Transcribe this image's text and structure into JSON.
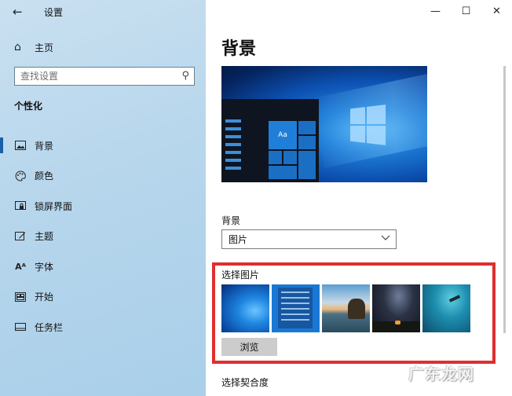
{
  "window": {
    "title": "设置",
    "controls": {
      "minimize": "—",
      "maximize": "☐",
      "close": "✕"
    }
  },
  "sidebar": {
    "home_label": "主页",
    "search_placeholder": "查找设置",
    "section_title": "个性化",
    "items": [
      {
        "label": "背景",
        "icon": "picture-icon",
        "active": true
      },
      {
        "label": "颜色",
        "icon": "palette-icon",
        "active": false
      },
      {
        "label": "锁屏界面",
        "icon": "lock-screen-icon",
        "active": false
      },
      {
        "label": "主题",
        "icon": "theme-brush-icon",
        "active": false
      },
      {
        "label": "字体",
        "icon": "font-icon",
        "active": false
      },
      {
        "label": "开始",
        "icon": "start-grid-icon",
        "active": false
      },
      {
        "label": "任务栏",
        "icon": "taskbar-icon",
        "active": false
      }
    ]
  },
  "main": {
    "page_title": "背景",
    "preview": {
      "tile_text": "Aa"
    },
    "background_label": "背景",
    "background_value": "图片",
    "choose_picture_label": "选择图片",
    "browse_label": "浏览",
    "fit_label": "选择契合度"
  },
  "colors": {
    "accent": "#1a5fa8",
    "highlight_border": "#e02e2e"
  },
  "watermark": "广东龙网"
}
